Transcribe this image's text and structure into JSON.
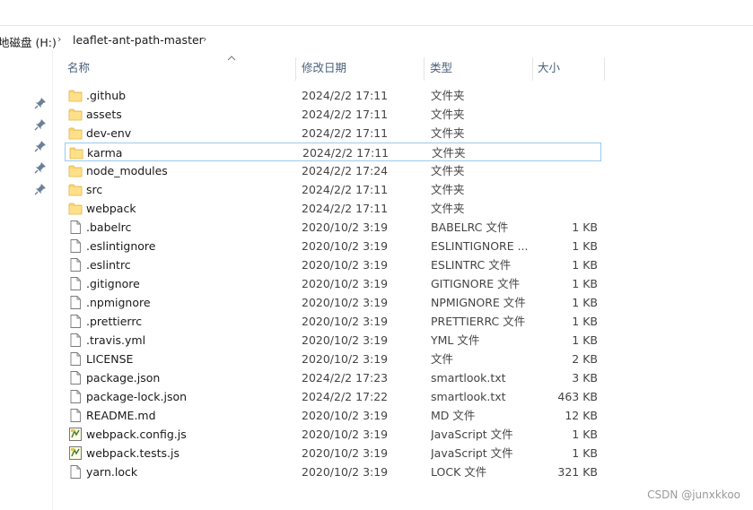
{
  "breadcrumb": {
    "drive": "地磁盘 (H:)",
    "folder": "leaflet-ant-path-master"
  },
  "columns": {
    "name": "名称",
    "date": "修改日期",
    "type": "类型",
    "size": "大小"
  },
  "files": [
    {
      "name": ".github",
      "date": "2024/2/2 17:11",
      "type": "文件夹",
      "size": "",
      "icon": "folder-icon"
    },
    {
      "name": "assets",
      "date": "2024/2/2 17:11",
      "type": "文件夹",
      "size": "",
      "icon": "folder-icon"
    },
    {
      "name": "dev-env",
      "date": "2024/2/2 17:11",
      "type": "文件夹",
      "size": "",
      "icon": "folder-icon"
    },
    {
      "name": "karma",
      "date": "2024/2/2 17:11",
      "type": "文件夹",
      "size": "",
      "icon": "folder-icon"
    },
    {
      "name": "node_modules",
      "date": "2024/2/2 17:24",
      "type": "文件夹",
      "size": "",
      "icon": "folder-icon"
    },
    {
      "name": "src",
      "date": "2024/2/2 17:11",
      "type": "文件夹",
      "size": "",
      "icon": "folder-icon"
    },
    {
      "name": "webpack",
      "date": "2024/2/2 17:11",
      "type": "文件夹",
      "size": "",
      "icon": "folder-icon"
    },
    {
      "name": ".babelrc",
      "date": "2020/10/2 3:19",
      "type": "BABELRC 文件",
      "size": "1 KB",
      "icon": "file-icon"
    },
    {
      "name": ".eslintignore",
      "date": "2020/10/2 3:19",
      "type": "ESLINTIGNORE ...",
      "size": "1 KB",
      "icon": "file-icon"
    },
    {
      "name": ".eslintrc",
      "date": "2020/10/2 3:19",
      "type": "ESLINTRC 文件",
      "size": "1 KB",
      "icon": "file-icon"
    },
    {
      "name": ".gitignore",
      "date": "2020/10/2 3:19",
      "type": "GITIGNORE 文件",
      "size": "1 KB",
      "icon": "file-icon"
    },
    {
      "name": ".npmignore",
      "date": "2020/10/2 3:19",
      "type": "NPMIGNORE 文件",
      "size": "1 KB",
      "icon": "file-icon"
    },
    {
      "name": ".prettierrc",
      "date": "2020/10/2 3:19",
      "type": "PRETTIERRC 文件",
      "size": "1 KB",
      "icon": "file-icon"
    },
    {
      "name": ".travis.yml",
      "date": "2020/10/2 3:19",
      "type": "YML 文件",
      "size": "1 KB",
      "icon": "file-icon"
    },
    {
      "name": "LICENSE",
      "date": "2020/10/2 3:19",
      "type": "文件",
      "size": "2 KB",
      "icon": "file-icon"
    },
    {
      "name": "package.json",
      "date": "2024/2/2 17:23",
      "type": "smartlook.txt",
      "size": "3 KB",
      "icon": "file-icon"
    },
    {
      "name": "package-lock.json",
      "date": "2024/2/2 17:22",
      "type": "smartlook.txt",
      "size": "463 KB",
      "icon": "file-icon"
    },
    {
      "name": "README.md",
      "date": "2020/10/2 3:19",
      "type": "MD 文件",
      "size": "12 KB",
      "icon": "file-icon"
    },
    {
      "name": "webpack.config.js",
      "date": "2020/10/2 3:19",
      "type": "JavaScript 文件",
      "size": "1 KB",
      "icon": "js-file-icon"
    },
    {
      "name": "webpack.tests.js",
      "date": "2020/10/2 3:19",
      "type": "JavaScript 文件",
      "size": "1 KB",
      "icon": "js-file-icon"
    },
    {
      "name": "yarn.lock",
      "date": "2020/10/2 3:19",
      "type": "LOCK 文件",
      "size": "321 KB",
      "icon": "file-icon"
    }
  ],
  "selected_item": "karma",
  "watermark": "CSDN @junxkkoo",
  "colors": {
    "folder": "#f8d775",
    "selection_border": "#99c9ef",
    "header_text": "#4c607a"
  }
}
